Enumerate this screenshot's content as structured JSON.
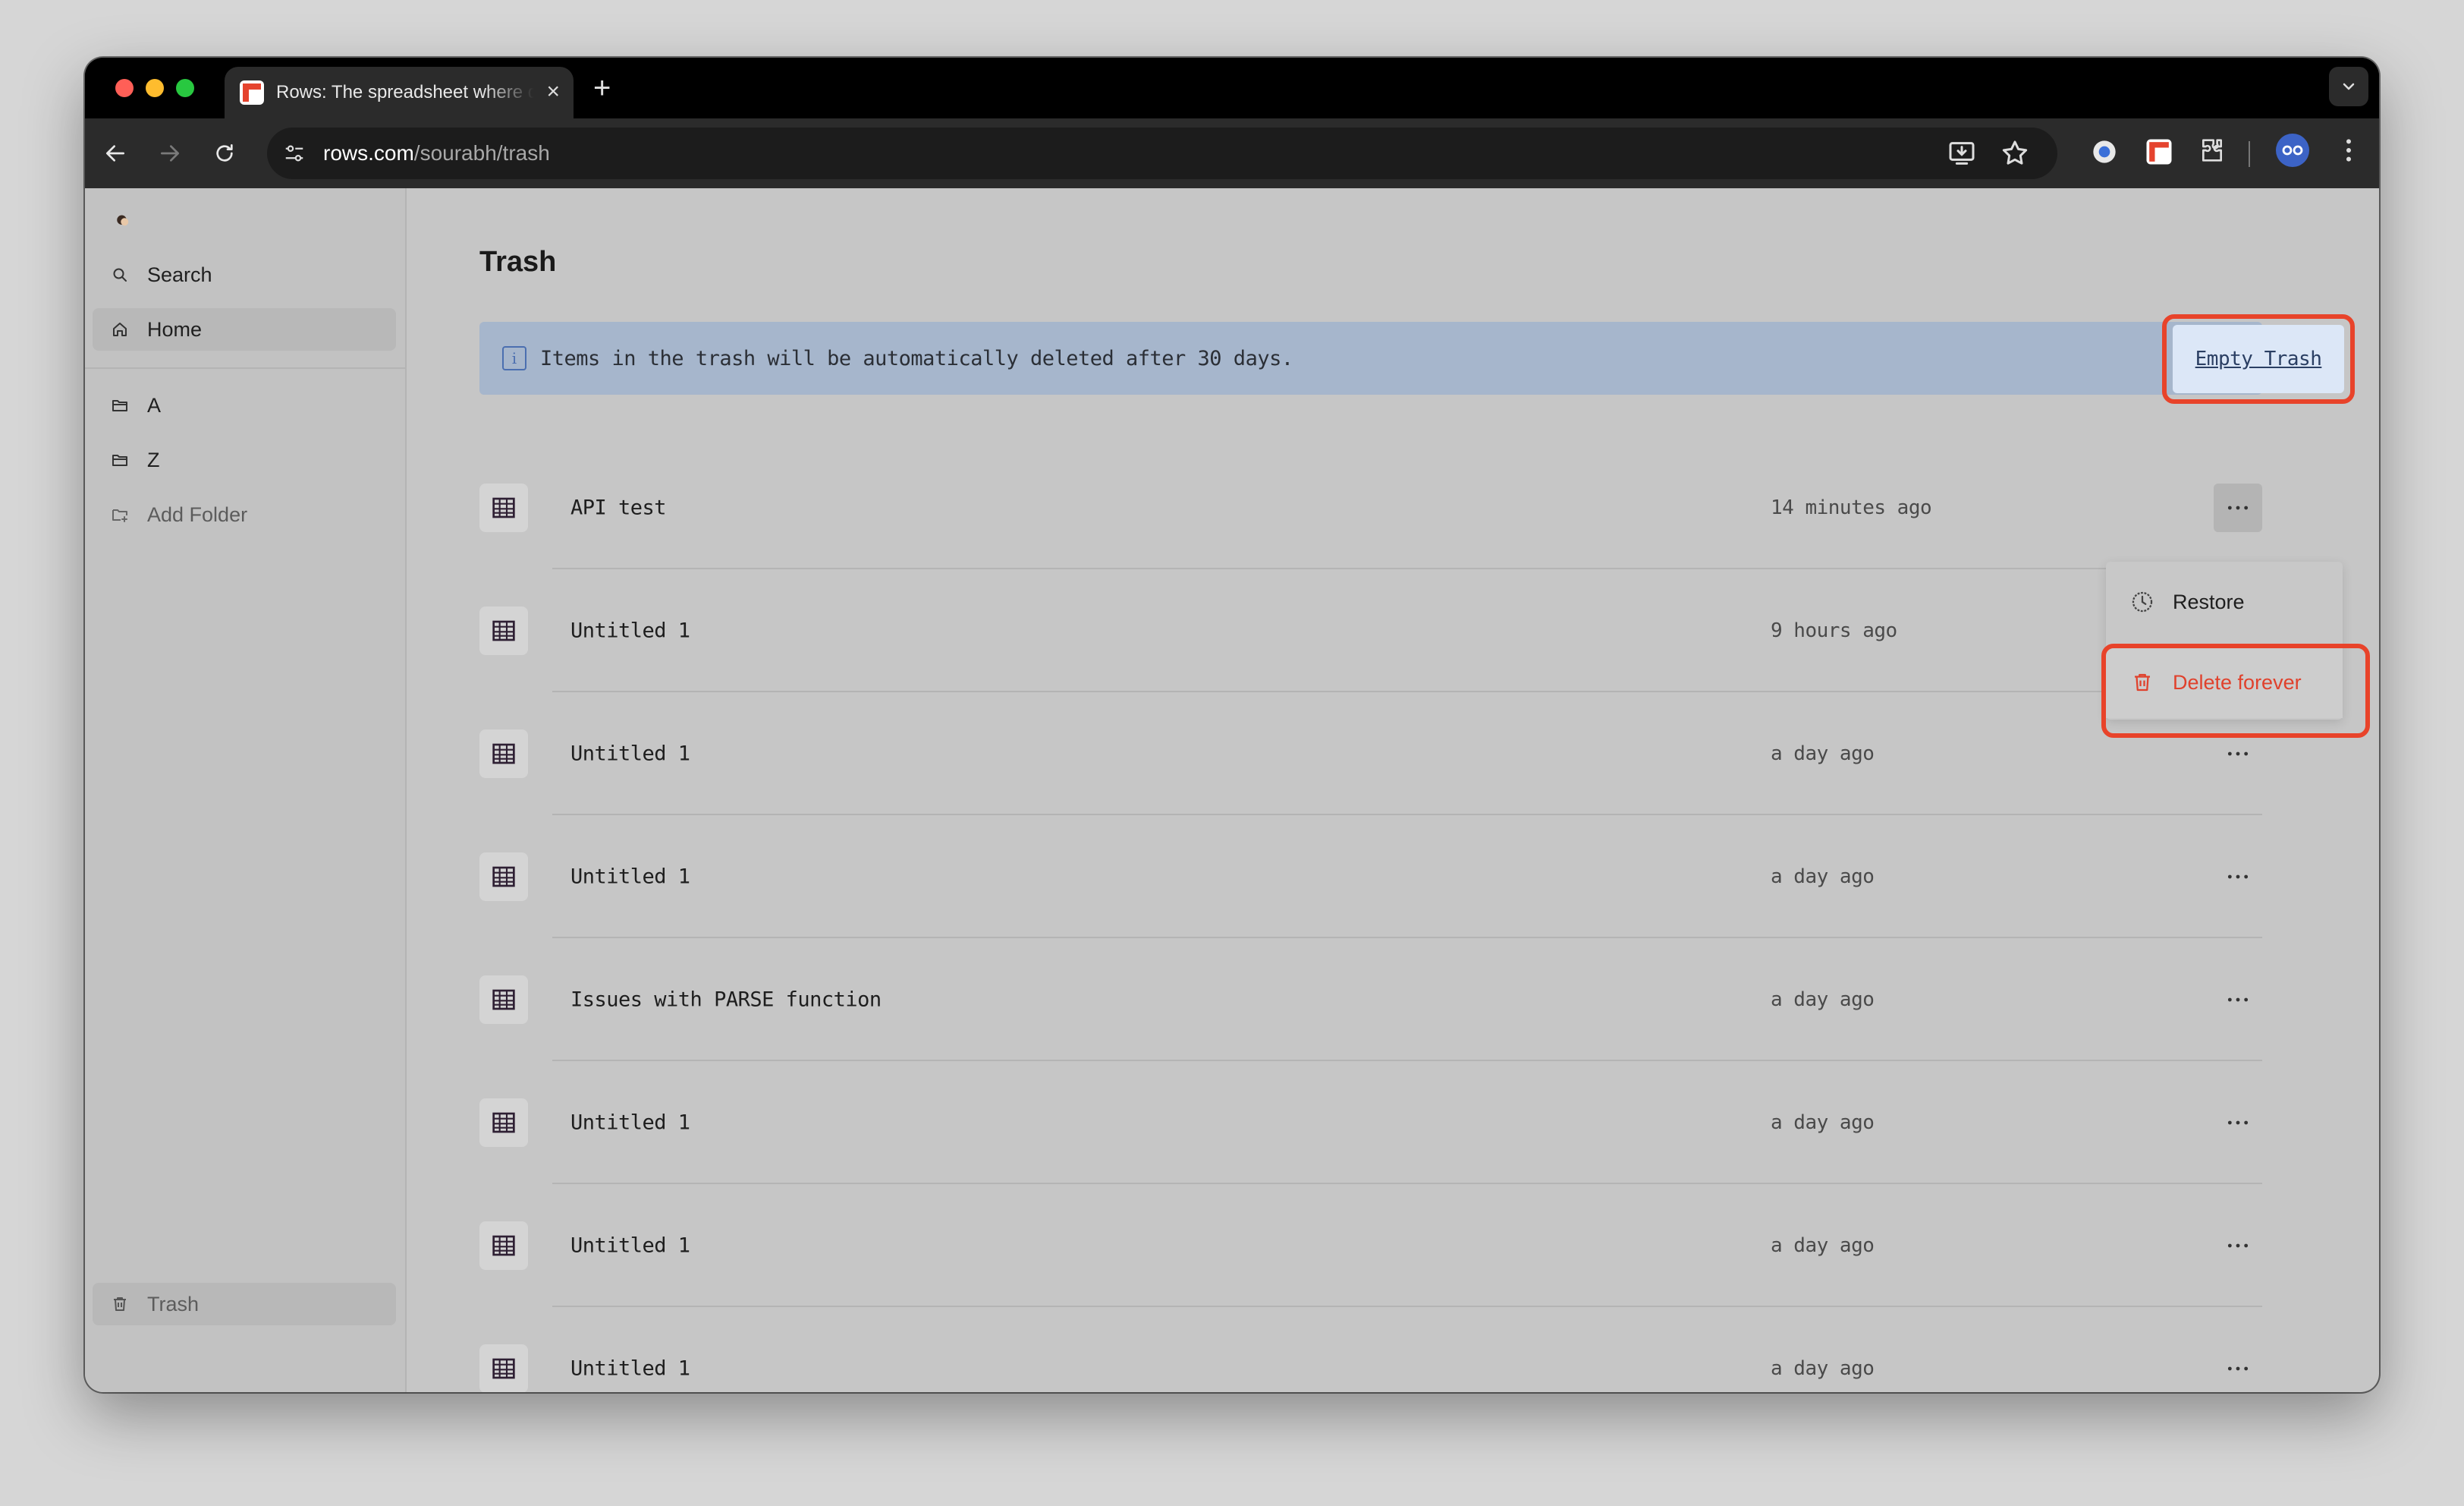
{
  "browser": {
    "tab_title": "Rows: The spreadsheet where data comes alive",
    "url_host": "rows.com",
    "url_path": "/sourabh/trash"
  },
  "sidebar": {
    "items": [
      {
        "label": "Search",
        "icon": "search-icon"
      },
      {
        "label": "Home",
        "icon": "home-icon",
        "active": true
      },
      {
        "label": "A",
        "icon": "folder-icon"
      },
      {
        "label": "Z",
        "icon": "folder-icon"
      },
      {
        "label": "Add Folder",
        "icon": "add-folder-icon"
      }
    ],
    "trash_label": "Trash"
  },
  "main": {
    "title": "Trash",
    "banner_text": "Items in the trash will be automatically deleted after 30 days.",
    "banner_icon": "i",
    "empty_trash_label": "Empty Trash",
    "rows": [
      {
        "name": "API test",
        "time": "14 minutes ago"
      },
      {
        "name": "Untitled 1",
        "time": "9 hours ago"
      },
      {
        "name": "Untitled 1",
        "time": "a day ago"
      },
      {
        "name": "Untitled 1",
        "time": "a day ago"
      },
      {
        "name": "Issues with PARSE function",
        "time": "a day ago"
      },
      {
        "name": "Untitled 1",
        "time": "a day ago"
      },
      {
        "name": "Untitled 1",
        "time": "a day ago"
      },
      {
        "name": "Untitled 1",
        "time": "a day ago"
      }
    ],
    "menu": {
      "restore_label": "Restore",
      "delete_label": "Delete forever"
    }
  },
  "colors": {
    "highlight": "#e8432a",
    "banner_bg": "#a6b6cc",
    "delete_text": "#e0412c"
  }
}
